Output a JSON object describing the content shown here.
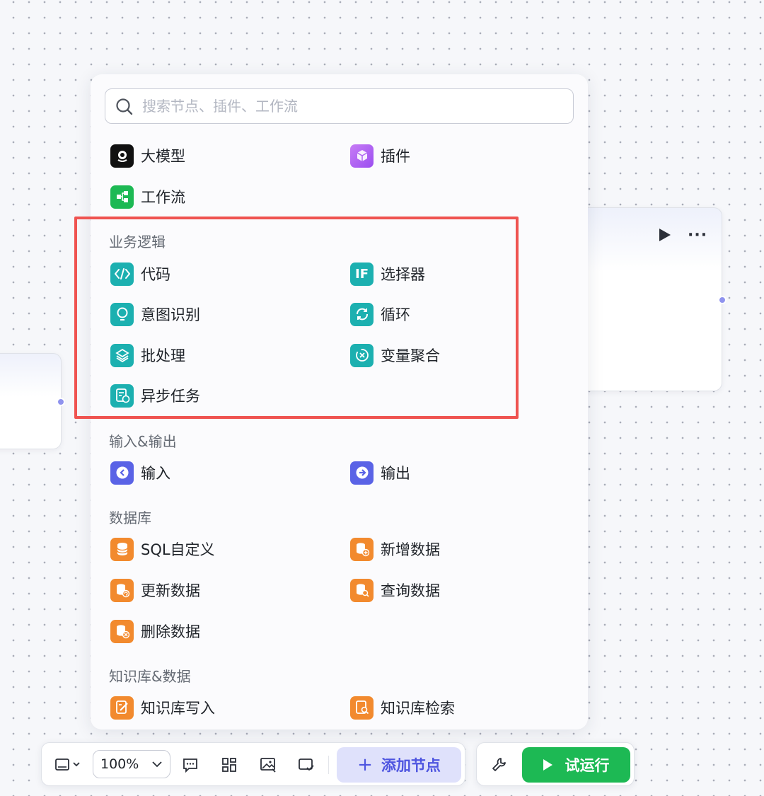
{
  "search": {
    "placeholder": "搜索节点、插件、工作流"
  },
  "top_items": [
    {
      "label": "大模型",
      "icon": "llm-icon"
    },
    {
      "label": "插件",
      "icon": "plugin-cube-icon"
    },
    {
      "label": "工作流",
      "icon": "workflow-icon"
    }
  ],
  "categories": [
    {
      "title": "业务逻辑",
      "items": [
        {
          "label": "代码",
          "icon": "code-icon"
        },
        {
          "label": "选择器",
          "icon": "if-selector-icon"
        },
        {
          "label": "意图识别",
          "icon": "intent-bulb-icon"
        },
        {
          "label": "循环",
          "icon": "loop-icon"
        },
        {
          "label": "批处理",
          "icon": "batch-layers-icon"
        },
        {
          "label": "变量聚合",
          "icon": "variable-aggregate-icon"
        },
        {
          "label": "异步任务",
          "icon": "async-task-icon"
        }
      ]
    },
    {
      "title": "输入&输出",
      "items": [
        {
          "label": "输入",
          "icon": "input-arrow-icon"
        },
        {
          "label": "输出",
          "icon": "output-arrow-icon"
        }
      ]
    },
    {
      "title": "数据库",
      "items": [
        {
          "label": "SQL自定义",
          "icon": "database-icon"
        },
        {
          "label": "新增数据",
          "icon": "database-add-icon"
        },
        {
          "label": "更新数据",
          "icon": "database-refresh-icon"
        },
        {
          "label": "查询数据",
          "icon": "database-search-icon"
        },
        {
          "label": "删除数据",
          "icon": "database-delete-icon"
        }
      ]
    },
    {
      "title": "知识库&数据",
      "items": [
        {
          "label": "知识库写入",
          "icon": "knowledge-write-icon"
        },
        {
          "label": "知识库检索",
          "icon": "knowledge-search-icon"
        }
      ]
    }
  ],
  "toolbar": {
    "zoom": "100%",
    "add_node_label": "添加节点",
    "test_run_label": "试运行"
  },
  "colors": {
    "highlight_border": "#ef5350",
    "teal_icon": "#1cb0b0",
    "orange_icon": "#f28a2e",
    "indigo_icon": "#5a63e6",
    "add_node_bg": "#dfe1fb",
    "add_node_text": "#4e55e0",
    "test_run_bg": "#1db954"
  }
}
